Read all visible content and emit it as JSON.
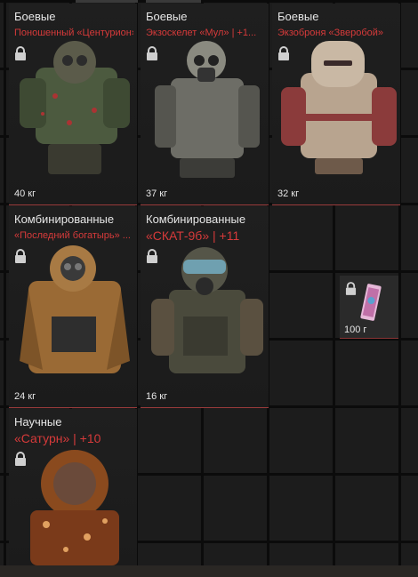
{
  "cards": [
    {
      "category": "Боевые",
      "name": "Поношенный «Центурион»",
      "weight": "40 кг",
      "locked": true
    },
    {
      "category": "Боевые",
      "name": "Экзоскелет «Мул» | +1...",
      "weight": "37 кг",
      "locked": true
    },
    {
      "category": "Боевые",
      "name": "Экзоброня «Зверобой»",
      "weight": "32 кг",
      "locked": true
    },
    {
      "category": "Комбинированные",
      "name": "«Последний богатырь» ...",
      "weight": "24 кг",
      "locked": true
    },
    {
      "category": "Комбинированные",
      "name": "«СКАТ-9б» | +11",
      "weight": "16 кг",
      "locked": true
    },
    {
      "category": "Научные",
      "name": "«Сатурн» | +10",
      "weight": "",
      "locked": true
    }
  ],
  "small_item": {
    "weight": "100 г",
    "locked": true,
    "icon": "ticket-icon"
  },
  "colors": {
    "accent_red": "#d63a3a",
    "text": "#e6e6e6",
    "background": "#1c1c1c"
  }
}
